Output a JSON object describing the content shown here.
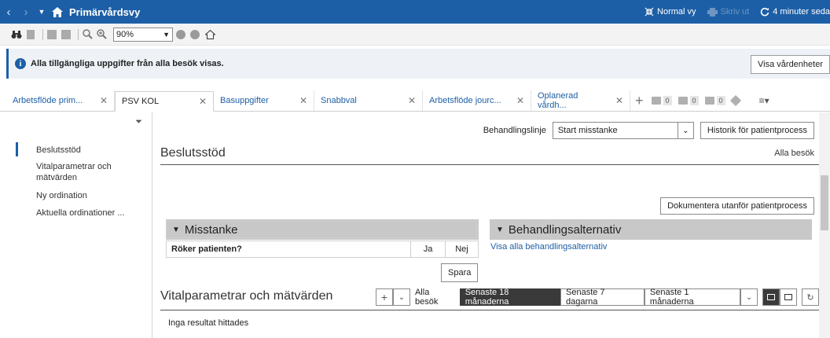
{
  "titlebar": {
    "title": "Primärvårdsvy",
    "normal_view": "Normal vy",
    "print": "Skriv ut",
    "refresh": "4 minuter seda"
  },
  "toolbar": {
    "zoom": "90%"
  },
  "banner": {
    "message": "Alla tillgängliga uppgifter från alla besök visas.",
    "button": "Visa vårdenheter"
  },
  "tabs": [
    {
      "label": "Arbetsflöde prim..."
    },
    {
      "label": "PSV KOL"
    },
    {
      "label": "Basuppgifter"
    },
    {
      "label": "Snabbval"
    },
    {
      "label": "Arbetsflöde jourc..."
    },
    {
      "label": "Oplanerad vårdh..."
    }
  ],
  "tab_badges": [
    "0",
    "0",
    "0"
  ],
  "sidebar": {
    "items": [
      {
        "label": "Beslutsstöd"
      },
      {
        "label": "Vitalparametrar och mätvärden"
      },
      {
        "label": "Ny ordination"
      },
      {
        "label": "Aktuella ordinationer ..."
      }
    ]
  },
  "main": {
    "treatment_line_label": "Behandlingslinje",
    "treatment_line_value": "Start misstanke",
    "history_button": "Historik för patientprocess",
    "decision_title": "Beslutsstöd",
    "all_visits": "Alla besök",
    "document_button": "Dokumentera utanför patientprocess",
    "suspicion_header": "Misstanke",
    "treatment_header": "Behandlingsalternativ",
    "question": "Röker patienten?",
    "yes": "Ja",
    "no": "Nej",
    "show_all_treatments": "Visa alla behandlingsalternativ",
    "save_button": "Spara",
    "vitals_title": "Vitalparametrar och mätvärden",
    "vitals_all_visits": "Alla besök",
    "period_18m": "Senaste 18 månaderna",
    "period_7d": "Senaste 7 dagarna",
    "period_1m": "Senaste 1 månaderna",
    "no_results": "Inga resultat hittades"
  },
  "colors": {
    "titlebar": "#1d5fa6",
    "selected_segment": "#3a3a3a",
    "panel_header": "#c8c8c8"
  }
}
